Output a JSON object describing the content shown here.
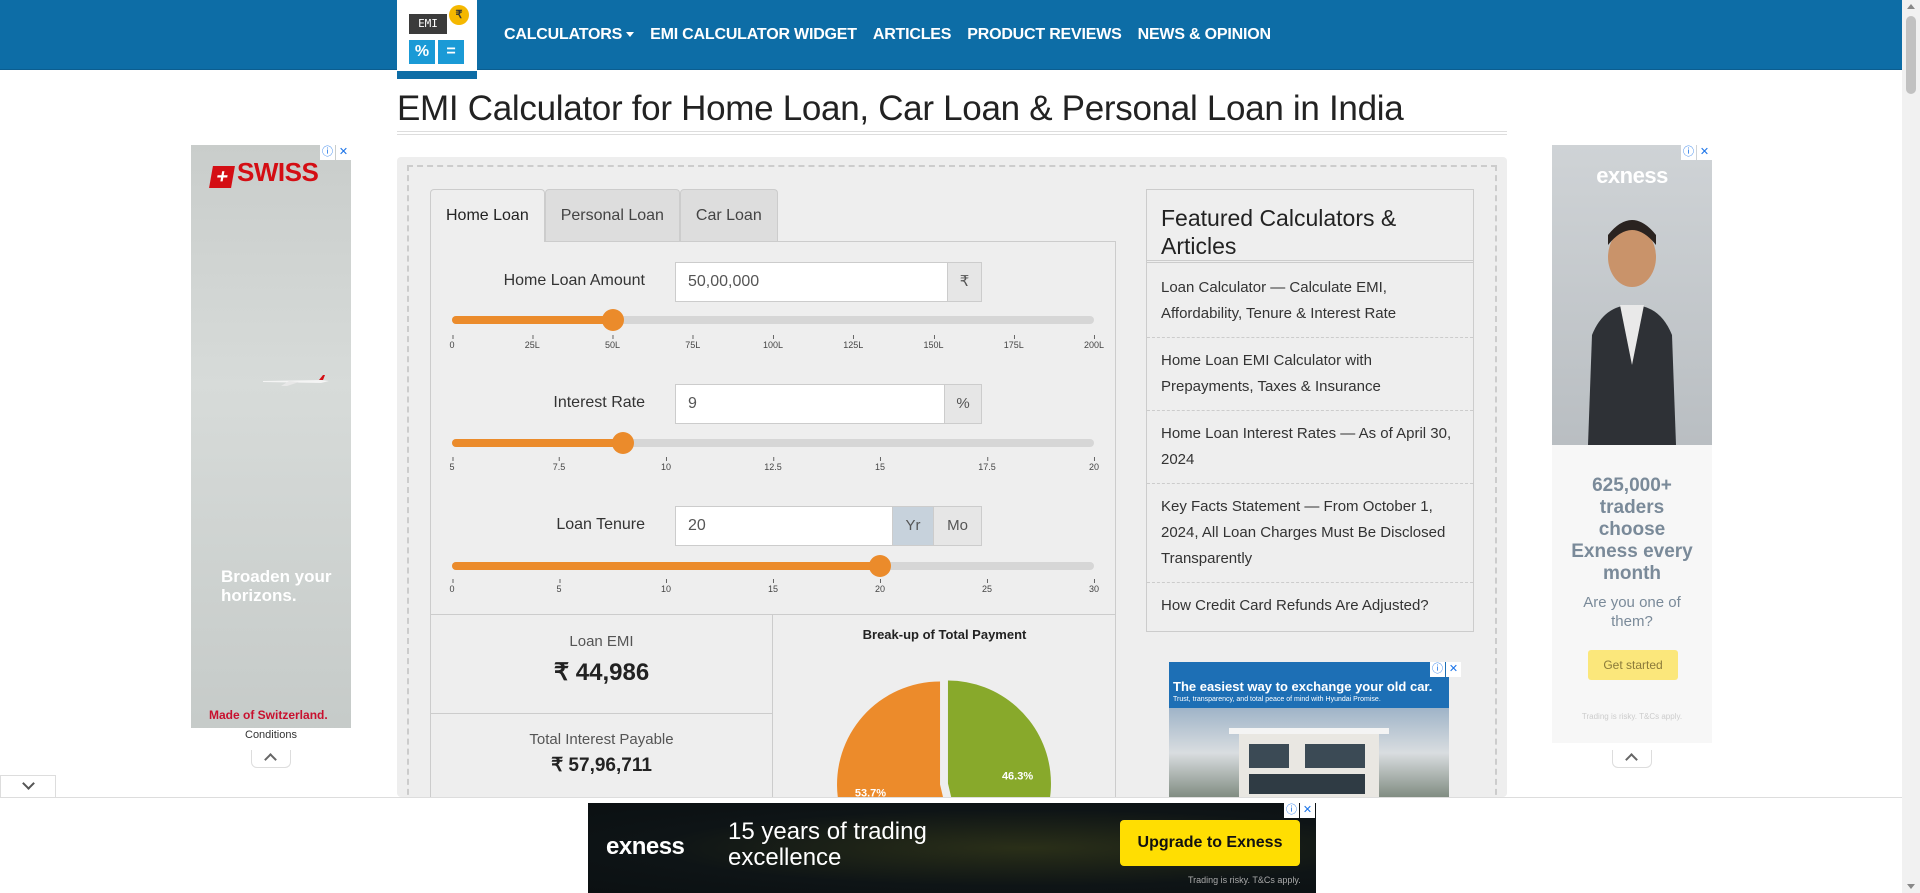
{
  "nav": {
    "logo": {
      "screen_text": "EMI",
      "coin": "₹",
      "key1": "%",
      "key2": "="
    },
    "items": [
      {
        "label": "CALCULATORS",
        "dropdown": true
      },
      {
        "label": "EMI CALCULATOR WIDGET"
      },
      {
        "label": "ARTICLES"
      },
      {
        "label": "PRODUCT REVIEWS"
      },
      {
        "label": "NEWS & OPINION"
      }
    ]
  },
  "page": {
    "title": "EMI Calculator for Home Loan, Car Loan & Personal Loan in India"
  },
  "tabs": [
    "Home Loan",
    "Personal Loan",
    "Car Loan"
  ],
  "calculator": {
    "amount": {
      "label": "Home Loan Amount",
      "value": "50,00,000",
      "unit": "₹",
      "ticks": [
        "0",
        "25L",
        "50L",
        "75L",
        "100L",
        "125L",
        "150L",
        "175L",
        "200L"
      ],
      "slider_fraction": 0.25
    },
    "rate": {
      "label": "Interest Rate",
      "value": "9",
      "unit": "%",
      "ticks": [
        "5",
        "7.5",
        "10",
        "12.5",
        "15",
        "17.5",
        "20"
      ],
      "slider_fraction": 0.2667
    },
    "tenure": {
      "label": "Loan Tenure",
      "value": "20",
      "unit_year": "Yr",
      "unit_month": "Mo",
      "ticks": [
        "0",
        "5",
        "10",
        "15",
        "20",
        "25",
        "30"
      ],
      "slider_fraction": 0.6667
    }
  },
  "results": {
    "emi_label": "Loan EMI",
    "emi_value": "₹ 44,986",
    "interest_label": "Total Interest Payable",
    "interest_value": "₹ 57,96,711"
  },
  "chart_data": {
    "type": "pie",
    "title": "Break-up of Total Payment",
    "slices": [
      {
        "label": "53.7%",
        "value": 53.7,
        "color": "#ec8b2b"
      },
      {
        "label": "46.3%",
        "value": 46.3,
        "color": "#88a92b"
      }
    ]
  },
  "featured": {
    "title": "Featured Calculators & Articles",
    "items": [
      "Loan Calculator — Calculate EMI, Affordability, Tenure & Interest Rate",
      "Home Loan EMI Calculator with Prepayments, Taxes & Insurance",
      "Home Loan Interest Rates — As of April 30, 2024",
      "Key Facts Statement — From October 1, 2024, All Loan Charges Must Be Disclosed Transparently",
      "How Credit Card Refunds Are Adjusted?"
    ]
  },
  "ads": {
    "left": {
      "brand": "SWISS",
      "tagline": "Broaden your horizons.",
      "made": "Made of Switzerland.",
      "conditions": "Conditions"
    },
    "right": {
      "brand": "exness",
      "stat": "625,000+ traders choose Exness every month",
      "question": "Are you one of them?",
      "cta": "Get started",
      "disclaimer": "Trading is risky. T&Cs apply."
    },
    "house": {
      "headline": "The easiest way to exchange your old car.",
      "sub": "Trust, transparency, and total peace of mind with Hyundai Promise."
    },
    "bottom": {
      "brand": "exness",
      "headline": "15 years of trading excellence",
      "cta": "Upgrade to Exness",
      "fine": "Trading is risky. T&Cs apply."
    }
  }
}
